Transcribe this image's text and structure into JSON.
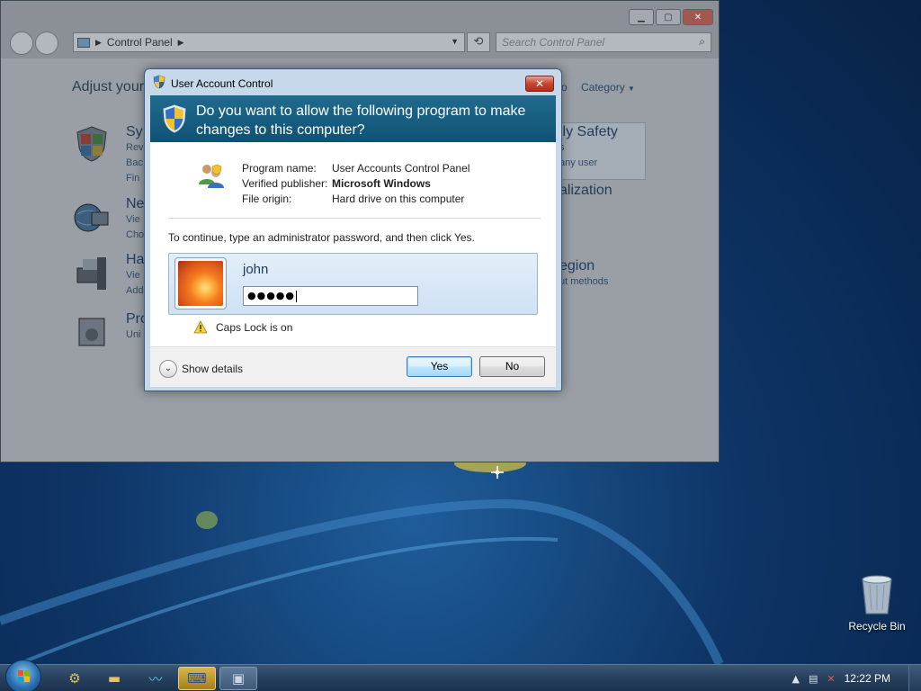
{
  "control_panel": {
    "address": "Control Panel",
    "search_placeholder": "Search Control Panel",
    "heading": "Adjust your",
    "view_by_value": "Category",
    "categories_left": [
      {
        "title": "Sy",
        "lines": [
          "Rev",
          "Bac",
          "Fin"
        ]
      },
      {
        "title": "Ne",
        "lines": [
          "Vie",
          "Cho"
        ]
      },
      {
        "title": "Ha",
        "lines": [
          "Vie",
          "Add"
        ]
      },
      {
        "title": "Pro",
        "lines": [
          "Uni"
        ]
      }
    ],
    "categories_right": [
      {
        "title": "ily Safety",
        "lines": [
          "s",
          "any user"
        ]
      },
      {
        "title": "alization",
        "lines": []
      },
      {
        "title": "egion",
        "lines": [
          "ut methods"
        ]
      }
    ],
    "view_by_fragment": "o"
  },
  "uac": {
    "title": "User Account Control",
    "question": "Do you want to allow the following program to make changes to this computer?",
    "program_name_label": "Program name:",
    "program_name_value": "User Accounts Control Panel",
    "publisher_label": "Verified publisher:",
    "publisher_value": "Microsoft Windows",
    "origin_label": "File origin:",
    "origin_value": "Hard drive on this computer",
    "instruction": "To continue, type an administrator password, and then click Yes.",
    "username": "john",
    "password_mask": "●●●●●",
    "caps_lock_warning": "Caps Lock is on",
    "show_details": "Show details",
    "yes_label": "Yes",
    "no_label": "No"
  },
  "desktop": {
    "recycle_bin_label": "Recycle Bin"
  },
  "taskbar": {
    "clock": "12:22 PM"
  },
  "colors": {
    "banner": "#105173",
    "desktop": "#0e3566"
  }
}
